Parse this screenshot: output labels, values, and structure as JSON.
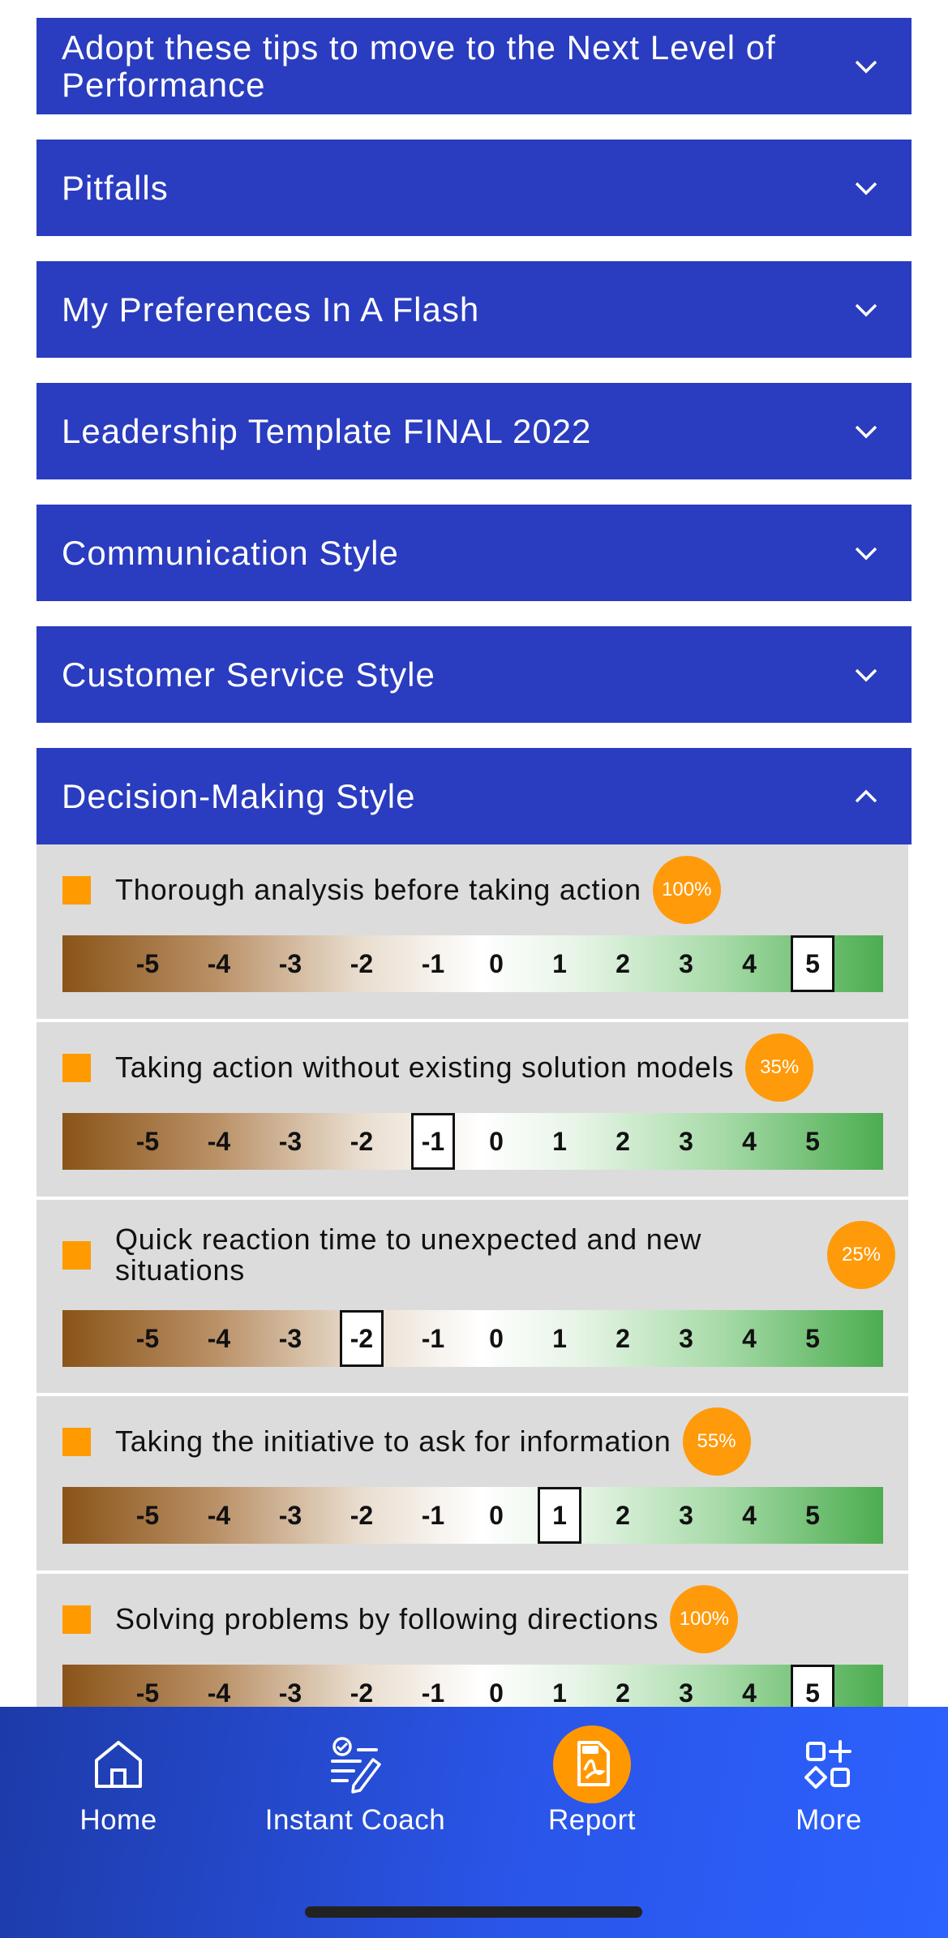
{
  "accordion": {
    "collapsed": [
      {
        "title": "Adopt these tips to move to the Next Level of Performance"
      },
      {
        "title": "Pitfalls"
      },
      {
        "title": "My Preferences In A Flash"
      },
      {
        "title": "Leadership Template FINAL 2022"
      },
      {
        "title": "Communication Style"
      },
      {
        "title": "Customer Service Style"
      }
    ],
    "open": {
      "title": "Decision-Making Style",
      "items": [
        {
          "label": "Thorough analysis before taking action",
          "percent": "100%",
          "selected": 5
        },
        {
          "label": "Taking action without existing solution models",
          "percent": "35%",
          "selected": -1
        },
        {
          "label": "Quick reaction time to unexpected and new situations",
          "percent": "25%",
          "selected": -2
        },
        {
          "label": "Taking the initiative to ask for information",
          "percent": "55%",
          "selected": 1
        },
        {
          "label": "Solving problems by following directions",
          "percent": "100%",
          "selected": 5
        }
      ]
    }
  },
  "scale": {
    "ticks": [
      "-5",
      "-4",
      "-3",
      "-2",
      "-1",
      "0",
      "1",
      "2",
      "3",
      "4",
      "5"
    ]
  },
  "nav": {
    "home": "Home",
    "coach": "Instant Coach",
    "report": "Report",
    "more": "More"
  },
  "colors": {
    "header": "#2a3cbf",
    "accent": "#ff9a00",
    "nav": "#2a55e8"
  }
}
